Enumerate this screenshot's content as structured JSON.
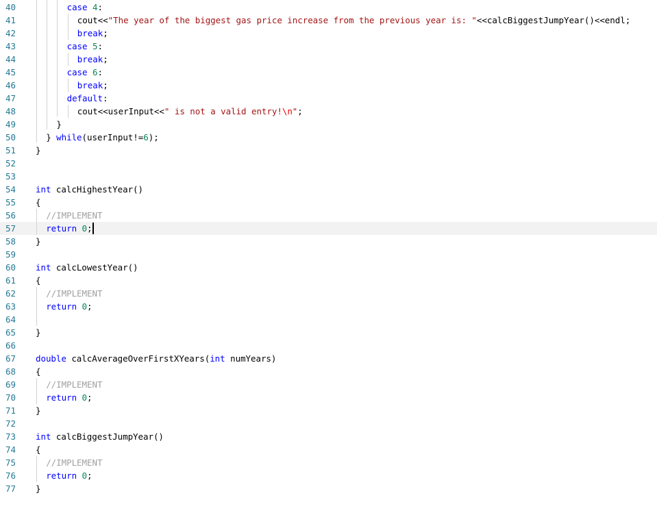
{
  "editor": {
    "current_line": 57,
    "lines": [
      {
        "n": "40",
        "indent": 3,
        "tokens": [
          {
            "t": "case ",
            "c": "kw"
          },
          {
            "t": "4",
            "c": "num"
          },
          {
            "t": ":",
            "c": "plain"
          }
        ]
      },
      {
        "n": "41",
        "indent": 4,
        "tokens": [
          {
            "t": "cout<<",
            "c": "plain"
          },
          {
            "t": "\"The year of the biggest gas price increase from the previous year is: \"",
            "c": "str"
          },
          {
            "t": "<<calcBiggestJumpYear()<<endl;",
            "c": "plain"
          }
        ]
      },
      {
        "n": "42",
        "indent": 4,
        "tokens": [
          {
            "t": "break",
            "c": "kw"
          },
          {
            "t": ";",
            "c": "plain"
          }
        ]
      },
      {
        "n": "43",
        "indent": 3,
        "tokens": [
          {
            "t": "case ",
            "c": "kw"
          },
          {
            "t": "5",
            "c": "num"
          },
          {
            "t": ":",
            "c": "plain"
          }
        ]
      },
      {
        "n": "44",
        "indent": 4,
        "tokens": [
          {
            "t": "break",
            "c": "kw"
          },
          {
            "t": ";",
            "c": "plain"
          }
        ]
      },
      {
        "n": "45",
        "indent": 3,
        "tokens": [
          {
            "t": "case ",
            "c": "kw"
          },
          {
            "t": "6",
            "c": "num"
          },
          {
            "t": ":",
            "c": "plain"
          }
        ]
      },
      {
        "n": "46",
        "indent": 4,
        "tokens": [
          {
            "t": "break",
            "c": "kw"
          },
          {
            "t": ";",
            "c": "plain"
          }
        ]
      },
      {
        "n": "47",
        "indent": 3,
        "tokens": [
          {
            "t": "default",
            "c": "kw"
          },
          {
            "t": ":",
            "c": "plain"
          }
        ]
      },
      {
        "n": "48",
        "indent": 4,
        "tokens": [
          {
            "t": "cout<<userInput<<",
            "c": "plain"
          },
          {
            "t": "\" is not a valid entry!",
            "c": "str"
          },
          {
            "t": "\\n",
            "c": "esc"
          },
          {
            "t": "\"",
            "c": "str"
          },
          {
            "t": ";",
            "c": "plain"
          }
        ]
      },
      {
        "n": "49",
        "indent": 2,
        "tokens": [
          {
            "t": "}",
            "c": "plain"
          }
        ]
      },
      {
        "n": "50",
        "indent": 1,
        "tokens": [
          {
            "t": "} ",
            "c": "plain"
          },
          {
            "t": "while",
            "c": "kw"
          },
          {
            "t": "(userInput!=",
            "c": "plain"
          },
          {
            "t": "6",
            "c": "num"
          },
          {
            "t": ");",
            "c": "plain"
          }
        ]
      },
      {
        "n": "51",
        "indent": 0,
        "tokens": [
          {
            "t": "}",
            "c": "plain"
          }
        ]
      },
      {
        "n": "52",
        "indent": 0,
        "tokens": []
      },
      {
        "n": "53",
        "indent": 0,
        "tokens": []
      },
      {
        "n": "54",
        "indent": 0,
        "tokens": [
          {
            "t": "int",
            "c": "kw"
          },
          {
            "t": " calcHighestYear()",
            "c": "plain"
          }
        ]
      },
      {
        "n": "55",
        "indent": 0,
        "tokens": [
          {
            "t": "{",
            "c": "plain"
          }
        ]
      },
      {
        "n": "56",
        "indent": 1,
        "tokens": [
          {
            "t": "//IMPLEMENT",
            "c": "cmt"
          }
        ]
      },
      {
        "n": "57",
        "indent": 1,
        "tokens": [
          {
            "t": "return",
            "c": "kw"
          },
          {
            "t": " ",
            "c": "plain"
          },
          {
            "t": "0",
            "c": "num"
          },
          {
            "t": ";",
            "c": "plain"
          }
        ]
      },
      {
        "n": "58",
        "indent": 0,
        "tokens": [
          {
            "t": "}",
            "c": "plain"
          }
        ]
      },
      {
        "n": "59",
        "indent": 0,
        "tokens": []
      },
      {
        "n": "60",
        "indent": 0,
        "tokens": [
          {
            "t": "int",
            "c": "kw"
          },
          {
            "t": " calcLowestYear()",
            "c": "plain"
          }
        ]
      },
      {
        "n": "61",
        "indent": 0,
        "tokens": [
          {
            "t": "{",
            "c": "plain"
          }
        ]
      },
      {
        "n": "62",
        "indent": 1,
        "tokens": [
          {
            "t": "//IMPLEMENT",
            "c": "cmt"
          }
        ]
      },
      {
        "n": "63",
        "indent": 1,
        "tokens": [
          {
            "t": "return",
            "c": "kw"
          },
          {
            "t": " ",
            "c": "plain"
          },
          {
            "t": "0",
            "c": "num"
          },
          {
            "t": ";",
            "c": "plain"
          }
        ]
      },
      {
        "n": "64",
        "indent": 0,
        "tokens": []
      },
      {
        "n": "65",
        "indent": 0,
        "tokens": [
          {
            "t": "}",
            "c": "plain"
          }
        ]
      },
      {
        "n": "66",
        "indent": 0,
        "tokens": []
      },
      {
        "n": "67",
        "indent": 0,
        "tokens": [
          {
            "t": "double",
            "c": "kw"
          },
          {
            "t": " calcAverageOverFirstXYears(",
            "c": "plain"
          },
          {
            "t": "int",
            "c": "kw"
          },
          {
            "t": " numYears)",
            "c": "plain"
          }
        ]
      },
      {
        "n": "68",
        "indent": 0,
        "tokens": [
          {
            "t": "{",
            "c": "plain"
          }
        ]
      },
      {
        "n": "69",
        "indent": 1,
        "tokens": [
          {
            "t": "//IMPLEMENT",
            "c": "cmt"
          }
        ]
      },
      {
        "n": "70",
        "indent": 1,
        "tokens": [
          {
            "t": "return",
            "c": "kw"
          },
          {
            "t": " ",
            "c": "plain"
          },
          {
            "t": "0",
            "c": "num"
          },
          {
            "t": ";",
            "c": "plain"
          }
        ]
      },
      {
        "n": "71",
        "indent": 0,
        "tokens": [
          {
            "t": "}",
            "c": "plain"
          }
        ]
      },
      {
        "n": "72",
        "indent": 0,
        "tokens": []
      },
      {
        "n": "73",
        "indent": 0,
        "tokens": [
          {
            "t": "int",
            "c": "kw"
          },
          {
            "t": " calcBiggestJumpYear()",
            "c": "plain"
          }
        ]
      },
      {
        "n": "74",
        "indent": 0,
        "tokens": [
          {
            "t": "{",
            "c": "plain"
          }
        ]
      },
      {
        "n": "75",
        "indent": 1,
        "tokens": [
          {
            "t": "//IMPLEMENT",
            "c": "cmt"
          }
        ]
      },
      {
        "n": "76",
        "indent": 1,
        "tokens": [
          {
            "t": "return",
            "c": "kw"
          },
          {
            "t": " ",
            "c": "plain"
          },
          {
            "t": "0",
            "c": "num"
          },
          {
            "t": ";",
            "c": "plain"
          }
        ]
      },
      {
        "n": "77",
        "indent": 0,
        "tokens": [
          {
            "t": "}",
            "c": "plain"
          }
        ]
      }
    ],
    "guides": [
      {
        "level": 0,
        "from": "40",
        "to": "50"
      },
      {
        "level": 1,
        "from": "40",
        "to": "49"
      },
      {
        "level": 2,
        "from": "40",
        "to": "48"
      },
      {
        "level": 3,
        "from": "41",
        "to": "42"
      },
      {
        "level": 3,
        "from": "44",
        "to": "44"
      },
      {
        "level": 3,
        "from": "46",
        "to": "46"
      },
      {
        "level": 3,
        "from": "48",
        "to": "48"
      },
      {
        "level": 0,
        "from": "56",
        "to": "57"
      },
      {
        "level": 0,
        "from": "62",
        "to": "64"
      },
      {
        "level": 0,
        "from": "69",
        "to": "70"
      },
      {
        "level": 0,
        "from": "75",
        "to": "76"
      }
    ]
  }
}
